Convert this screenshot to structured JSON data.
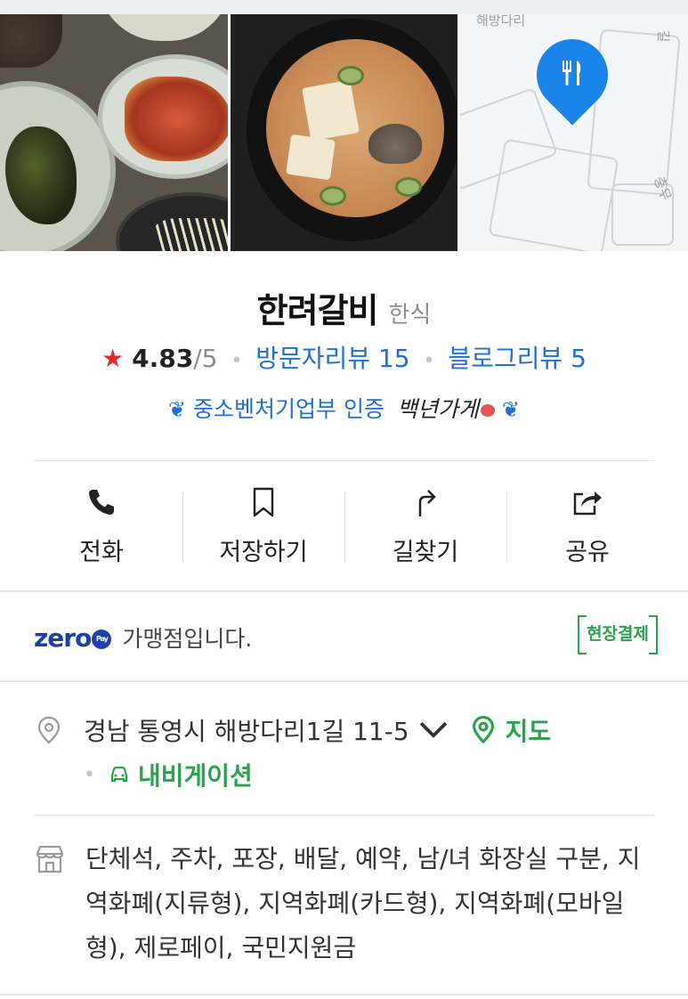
{
  "colors": {
    "star": "#e32b2b",
    "link_blue": "#1e6fd6",
    "green": "#2aa24a",
    "zero_pay": "#1d3fa8",
    "map_pin": "#1a84e8"
  },
  "photos": [
    {
      "icon": "photo-side-dishes"
    },
    {
      "icon": "photo-stew"
    },
    {
      "icon": "map-thumbnail",
      "map_labels": [
        "해방다리",
        "길",
        "충무"
      ]
    }
  ],
  "place": {
    "name": "한려갈비",
    "category": "한식",
    "rating": "4.83",
    "rating_max": "/5",
    "visitor_reviews": "방문자리뷰 15",
    "blog_reviews": "블로그리뷰 5",
    "certification": "중소벤처기업부 인증",
    "certification_script": "백년가게"
  },
  "actions": [
    {
      "label": "전화",
      "icon": "phone-icon"
    },
    {
      "label": "저장하기",
      "icon": "bookmark-icon"
    },
    {
      "label": "길찾기",
      "icon": "directions-icon"
    },
    {
      "label": "공유",
      "icon": "share-icon"
    }
  ],
  "zeropay": {
    "logo": "zero",
    "logo_badge": "Pay",
    "text": "가맹점입니다.",
    "badge": "현장결제"
  },
  "address": {
    "text": "경남 통영시 해방다리1길 11-5",
    "map_link": "지도",
    "navigation_link": "내비게이션"
  },
  "amenities": {
    "text": "단체석, 주차, 포장, 배달, 예약, 남/녀 화장실 구분, 지역화폐(지류형), 지역화폐(카드형), 지역화폐(모바일형), 제로페이, 국민지원금"
  }
}
